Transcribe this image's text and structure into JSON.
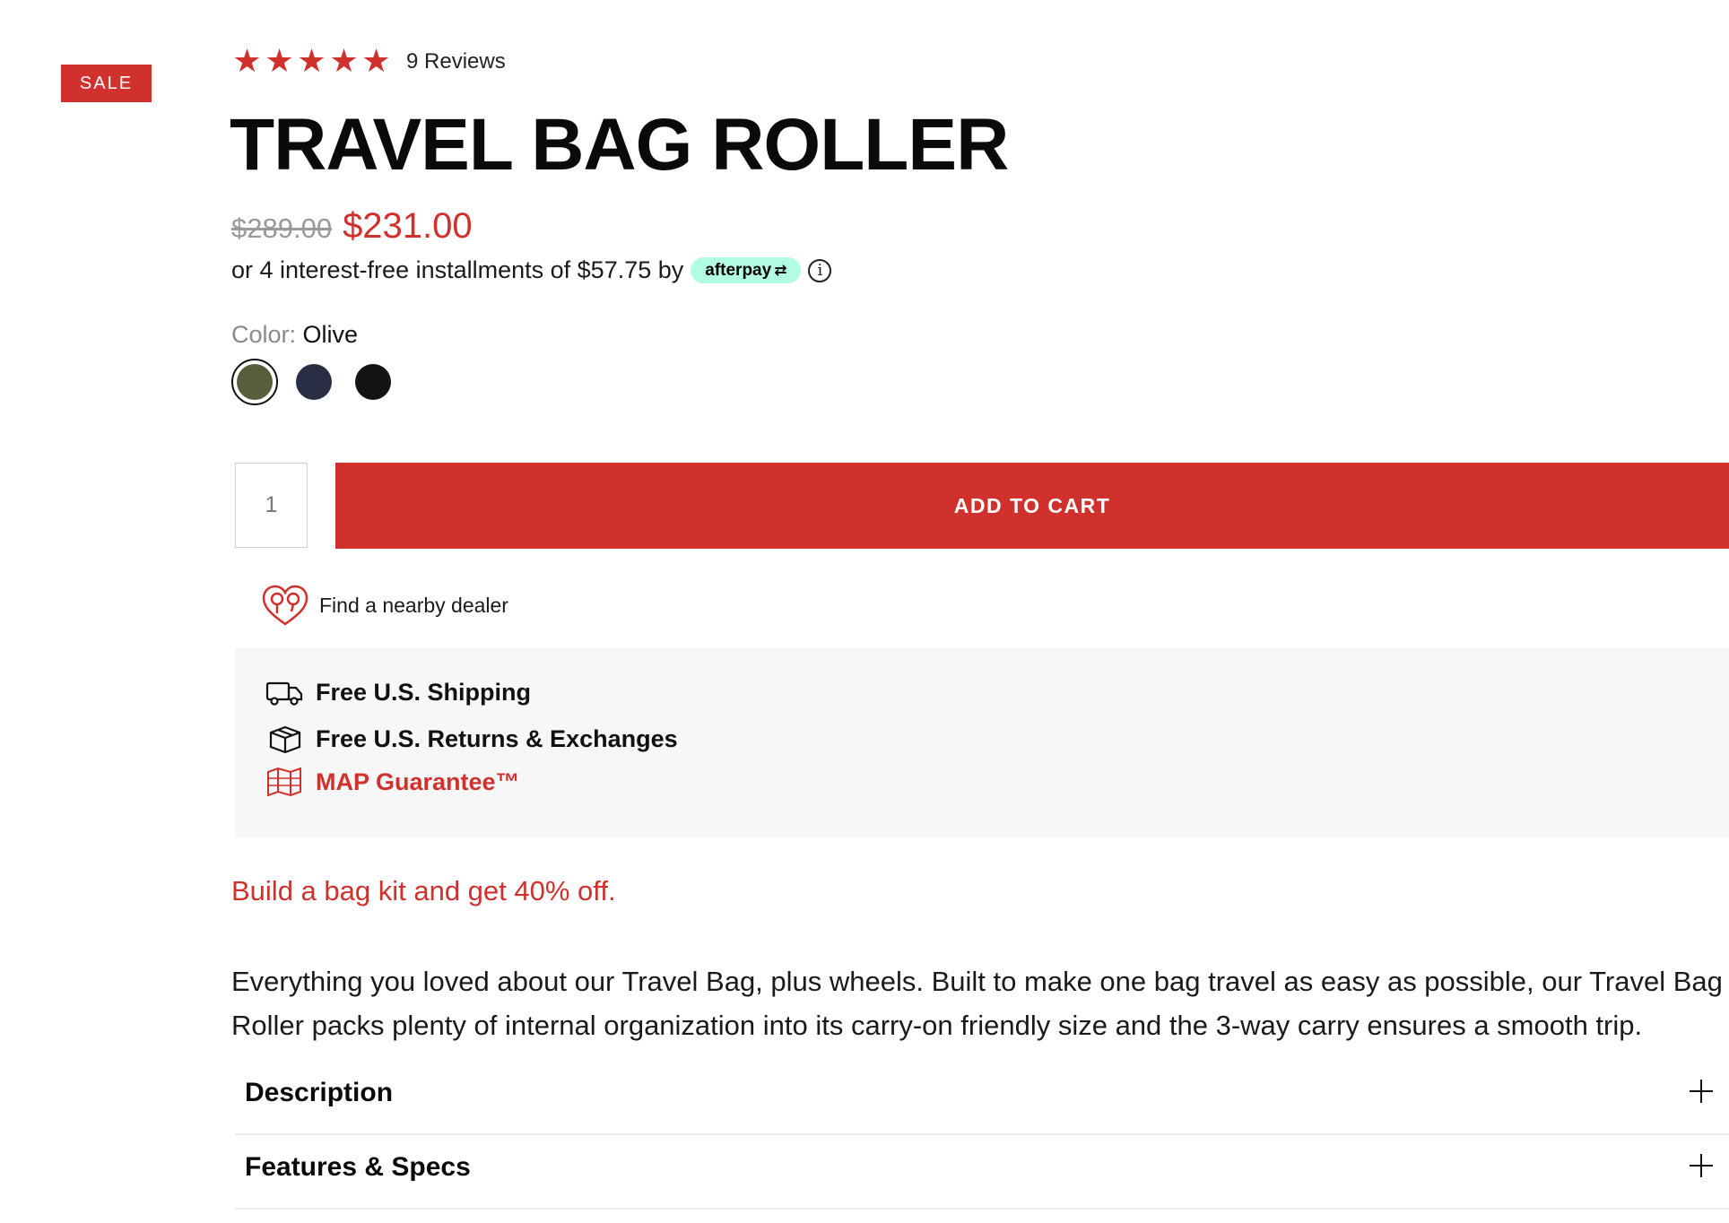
{
  "badge": {
    "label": "SALE"
  },
  "rating": {
    "stars": 5,
    "reviews_label": "9 Reviews"
  },
  "product": {
    "title": "TRAVEL BAG ROLLER"
  },
  "price": {
    "original": "$289.00",
    "sale": "$231.00"
  },
  "afterpay": {
    "text": "or 4 interest-free installments of $57.75 by",
    "brand": "afterpay",
    "info_icon": "info-icon"
  },
  "color": {
    "label": "Color:",
    "selected": "Olive",
    "options": [
      {
        "name": "Olive",
        "hex": "#5a5d3c"
      },
      {
        "name": "Navy",
        "hex": "#2a2e45"
      },
      {
        "name": "Black",
        "hex": "#141414"
      }
    ]
  },
  "cart": {
    "quantity": "1",
    "button_label": "ADD TO CART"
  },
  "dealer": {
    "label": "Find a nearby dealer",
    "icon": "location-heart-icon"
  },
  "benefits": [
    {
      "label": "Free U.S. Shipping",
      "icon": "truck-icon"
    },
    {
      "label": "Free U.S. Returns & Exchanges",
      "icon": "box-icon"
    },
    {
      "label": "MAP Guarantee™",
      "icon": "map-icon"
    }
  ],
  "promo": {
    "text": "Build a bag kit and get 40% off."
  },
  "description": {
    "text": "Everything you loved about our Travel Bag, plus wheels. Built to make one bag travel as easy as possible, our Travel Bag Roller packs plenty of internal organization into its carry-on friendly size and the 3-way carry ensures a smooth trip."
  },
  "accordions": [
    {
      "title": "Description"
    },
    {
      "title": "Features & Specs"
    }
  ],
  "colors": {
    "accent": "#d0312d",
    "afterpay_mint": "#b2fce4",
    "panel_bg": "#f7f7f7"
  }
}
